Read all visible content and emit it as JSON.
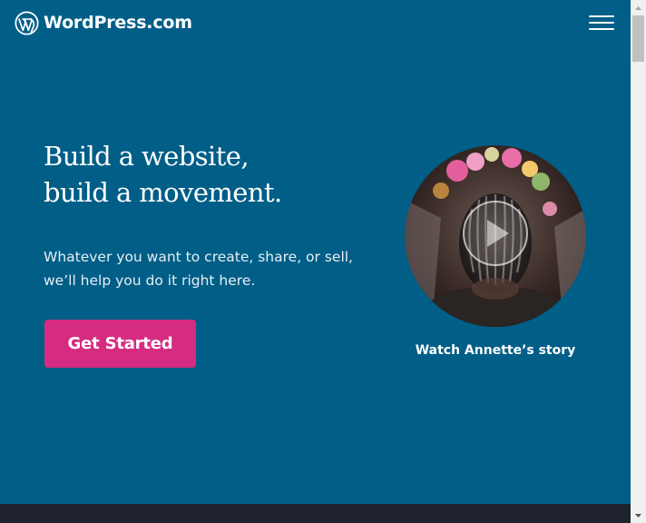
{
  "header": {
    "logo_text": "WordPress.com",
    "logo_icon": "wordpress-logo-icon",
    "menu_icon": "hamburger-menu-icon"
  },
  "hero": {
    "title_line1": "Build a website,",
    "title_line2": "build a movement.",
    "subtitle_line1": "Whatever you want to create, share, or sell,",
    "subtitle_line2": "we’ll help you do it right here.",
    "cta_label": "Get Started"
  },
  "video": {
    "caption": "Watch Annette’s story",
    "play_icon": "play-icon"
  },
  "colors": {
    "background": "#005e87",
    "cta": "#d52c82",
    "bottom_strip": "#1f2330"
  }
}
